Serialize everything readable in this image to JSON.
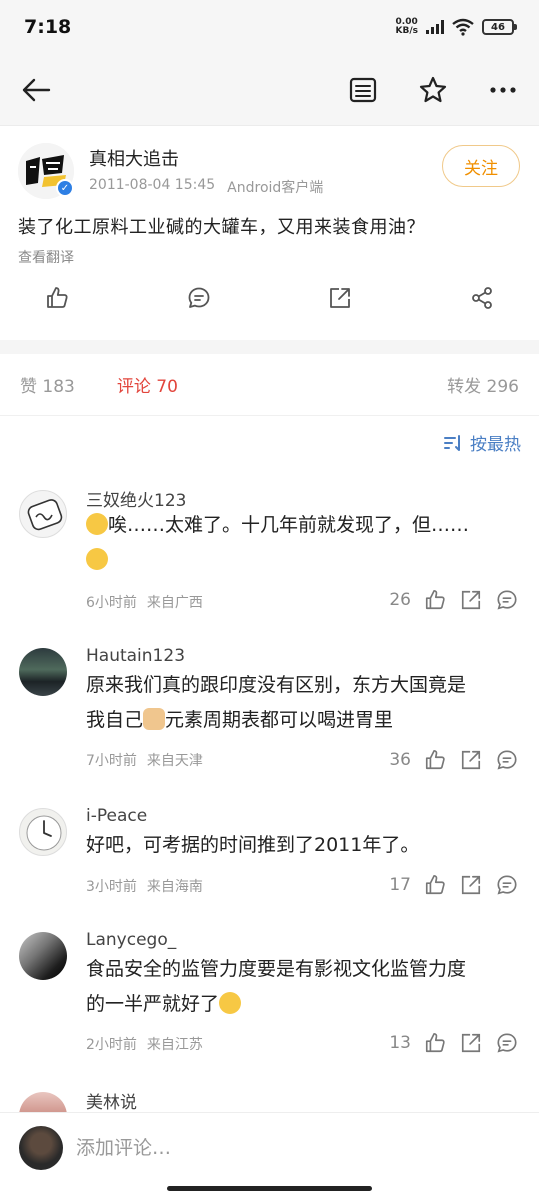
{
  "status_bar": {
    "time": "7:18",
    "net_speed_top": "0.00",
    "net_speed_bottom": "KB/s",
    "hd": "HD",
    "battery": "46"
  },
  "nav": {
    "back_icon": "arrow-left-icon",
    "list_icon": "list-icon",
    "star_icon": "star-icon",
    "more_icon": "more-icon"
  },
  "post": {
    "author": "真相大追击",
    "date": "2011-08-04 15:45",
    "client": "Android客户端",
    "follow_label": "关注",
    "text": "装了化工原料工业碱的大罐车，又用来装食用油？",
    "translate_label": "查看翻译"
  },
  "tabs": {
    "likes": "赞 183",
    "comments": "评论 70",
    "reposts": "转发 296"
  },
  "sort_label": "按最热",
  "comments": [
    {
      "name": "三奴绝火123",
      "text": "唉……太难了。十几年前就发现了，但……",
      "time": "6小时前",
      "location": "来自广西",
      "likes": "26"
    },
    {
      "name": "Hautain123",
      "text1": "原来我们真的跟印度没有区别，东方大国竟是",
      "text2": "我自己",
      "text3": "元素周期表都可以喝进胃里",
      "time": "7小时前",
      "location": "来自天津",
      "likes": "36"
    },
    {
      "name": "i-Peace",
      "text": "好吧，可考据的时间推到了2011年了。",
      "time": "3小时前",
      "location": "来自海南",
      "likes": "17"
    },
    {
      "name": "Lanycego_",
      "text1": "食品安全的监管力度要是有影视文化监管力度",
      "text2": "的一半严就好了",
      "time": "2小时前",
      "location": "来自江苏",
      "likes": "13"
    },
    {
      "name": "美林说"
    }
  ],
  "comment_input_placeholder": "添加评论…"
}
